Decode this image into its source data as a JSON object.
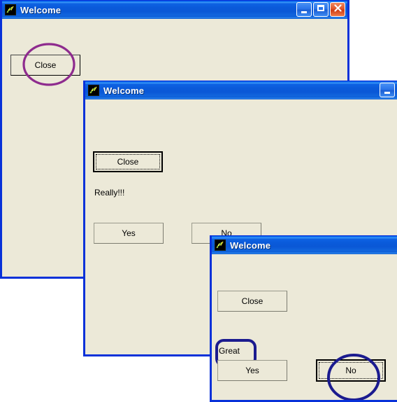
{
  "app": {
    "window_title": "Welcome",
    "icon_name": "tk-feather-icon",
    "colors": {
      "titlebar_blue": "#0a58d6",
      "client_bg": "#ece9d8",
      "window_border": "#0831d9",
      "annotation_purple": "#8e2b8e",
      "annotation_navy": "#1b1b8f",
      "close_button_red": "#d8441c"
    }
  },
  "caption_buttons": {
    "minimize": {
      "label": "Minimize",
      "icon": "minimize-icon"
    },
    "maximize": {
      "label": "Maximize",
      "icon": "maximize-icon"
    },
    "close": {
      "label": "Close",
      "icon": "close-x-icon"
    }
  },
  "windows": [
    {
      "id": "win1",
      "title": "Welcome",
      "buttons": [
        {
          "name": "close-button",
          "label": "Close",
          "focused": false
        }
      ],
      "labels": [],
      "annotations": [
        {
          "name": "annotation-circle-close",
          "shape": "circle",
          "color": "#8e2b8e",
          "target": "Close"
        }
      ]
    },
    {
      "id": "win2",
      "title": "Welcome",
      "buttons": [
        {
          "name": "close-button",
          "label": "Close",
          "focused": true
        },
        {
          "name": "yes-button",
          "label": "Yes",
          "focused": false
        },
        {
          "name": "no-button",
          "label": "No",
          "focused": false
        }
      ],
      "labels": [
        {
          "name": "really-label",
          "text": "Really!!!"
        }
      ],
      "annotations": []
    },
    {
      "id": "win3",
      "title": "Welcome",
      "buttons": [
        {
          "name": "close-button",
          "label": "Close",
          "focused": false
        },
        {
          "name": "yes-button",
          "label": "Yes",
          "focused": false
        },
        {
          "name": "no-button",
          "label": "No",
          "focused": true
        }
      ],
      "labels": [
        {
          "name": "great-label",
          "text": "Great"
        }
      ],
      "annotations": [
        {
          "name": "annotation-rect-great",
          "shape": "rounded-rect",
          "color": "#1b1b8f",
          "target": "Great"
        },
        {
          "name": "annotation-circle-no",
          "shape": "circle",
          "color": "#1b1b8f",
          "target": "No"
        }
      ]
    }
  ]
}
